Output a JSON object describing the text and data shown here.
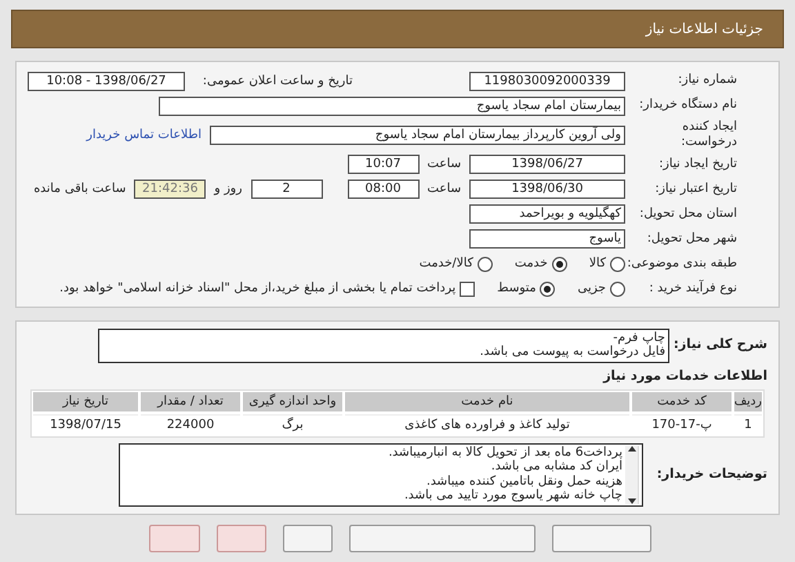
{
  "header": {
    "title": "جزئیات اطلاعات نیاز"
  },
  "details": {
    "need_number": {
      "label": "شماره نیاز:",
      "value": "1198030092000339"
    },
    "announce": {
      "label": "تاریخ و ساعت اعلان عمومی:",
      "value": "1398/06/27 - 10:08"
    },
    "buyer": {
      "label": "نام دستگاه خریدار:",
      "value": "بیمارستان امام سجاد یاسوج"
    },
    "creator": {
      "label": "ایجاد کننده درخواست:",
      "value": "ولی آروین کارپرداز بیمارستان امام سجاد یاسوج",
      "link": "اطلاعات تماس خریدار"
    },
    "created": {
      "label": "تاریخ ایجاد نیاز:",
      "date": "1398/06/27",
      "time_label": "ساعت",
      "time": "10:07"
    },
    "valid": {
      "label": "تاریخ اعتبار نیاز:",
      "date": "1398/06/30",
      "time_label": "ساعت",
      "time": "08:00",
      "days": "2",
      "days_label": "روز و",
      "remaining": "21:42:36",
      "remaining_label": "ساعت باقی مانده"
    },
    "province": {
      "label": "استان محل تحویل:",
      "value": "کهگیلویه و بویراحمد"
    },
    "city": {
      "label": "شهر محل تحویل:",
      "value": "یاسوج"
    },
    "category": {
      "label": "طبقه بندی موضوعی:",
      "options": [
        {
          "label": "کالا",
          "selected": false
        },
        {
          "label": "خدمت",
          "selected": true
        },
        {
          "label": "کالا/خدمت",
          "selected": false
        }
      ]
    },
    "process": {
      "label": "نوع فرآیند خرید :",
      "options": [
        {
          "label": "جزیی",
          "selected": false
        },
        {
          "label": "متوسط",
          "selected": true
        }
      ],
      "treasury": {
        "checked": false,
        "label": "پرداخت تمام یا بخشی از مبلغ خرید،از محل \"اسناد خزانه اسلامی\" خواهد بود."
      }
    }
  },
  "description": {
    "label": "شرح کلی نیاز:",
    "lines": [
      "چاپ فرم-",
      "فایل درخواست به پیوست می باشد."
    ]
  },
  "services": {
    "heading": "اطلاعات خدمات مورد نیاز",
    "columns": [
      "ردیف",
      "کد خدمت",
      "نام خدمت",
      "واحد اندازه گیری",
      "تعداد / مقدار",
      "تاریخ نیاز"
    ],
    "rows": [
      [
        "1",
        "پ-17-170",
        "تولید کاغذ و فراورده های کاغذی",
        "برگ",
        "224000",
        "1398/07/15"
      ]
    ]
  },
  "notes": {
    "label": "توضیحات خریدار:",
    "lines": [
      "پرداخت6 ماه بعد از تحویل کالا به انبارمیباشد.",
      "ایران کد مشابه می باشد.",
      "هزینه حمل ونقل باتامین کننده میباشد.",
      "چاپ خانه شهر یاسوج مورد تایید می باشد."
    ]
  },
  "buttons": [
    {
      "kind": "plain"
    },
    {
      "kind": "plain"
    },
    {
      "kind": "plain"
    },
    {
      "kind": "alert"
    },
    {
      "kind": "alert"
    }
  ]
}
